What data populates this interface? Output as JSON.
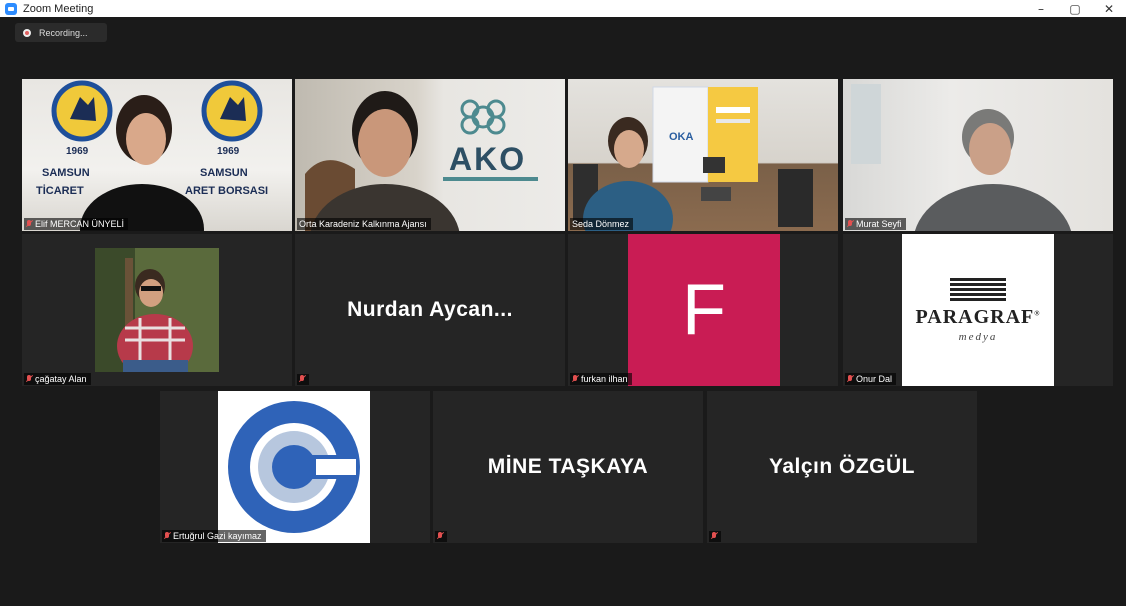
{
  "window": {
    "title": "Zoom Meeting",
    "minimize": "–",
    "maximize": "▢",
    "close": "✕"
  },
  "recording": {
    "label": "Recording..."
  },
  "colors": {
    "active_speaker_border": "#b9e36e",
    "muted_red": "#e35050",
    "f_avatar_bg": "#c91c54",
    "logo_blue": "#2f63b8"
  },
  "participants": [
    {
      "name": "Elif MERCAN ÜNYELİ",
      "muted": true,
      "video": "camera"
    },
    {
      "name": "Orta Karadeniz Kalkınma Ajansı",
      "muted": false,
      "video": "camera"
    },
    {
      "name": "Seda Dönmez",
      "muted": false,
      "video": "camera",
      "active": true
    },
    {
      "name": "Murat Seyfi",
      "muted": true,
      "video": "camera"
    },
    {
      "name": "çağatay Alan",
      "muted": true,
      "video": "profile-photo"
    },
    {
      "name": "",
      "display_name": "Nurdan  Aycan...",
      "muted": true,
      "video": "name-only"
    },
    {
      "name": "furkan ilhan",
      "muted": true,
      "video": "letter-avatar",
      "avatar_letter": "F"
    },
    {
      "name": "Onur Dal",
      "muted": true,
      "video": "logo-avatar",
      "logo_text": "PARAGRAF",
      "logo_mark": "®",
      "logo_sub": "medya"
    },
    {
      "name": "Ertuğrul Gazi kayımaz",
      "muted": true,
      "video": "logo-avatar"
    },
    {
      "name": "",
      "display_name": "MİNE TAŞKAYA",
      "muted": true,
      "video": "name-only"
    },
    {
      "name": "",
      "display_name": "Yalçın ÖZGÜL",
      "muted": true,
      "video": "name-only"
    }
  ],
  "backdrops": {
    "samsun_banner": [
      "SAMSUN",
      "SAMSUN",
      "TİCARET",
      "ARET BORSASI"
    ],
    "seal_year": [
      "1969",
      "1969"
    ],
    "ako_logo": "AKO",
    "oka_logo": "OKA"
  }
}
